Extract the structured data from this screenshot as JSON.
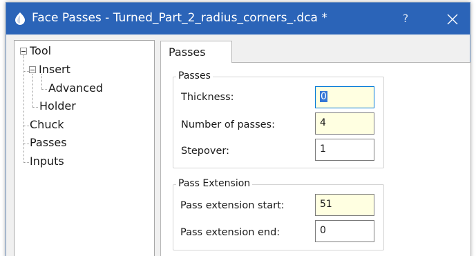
{
  "window": {
    "title": "Face Passes - Turned_Part_2_radius_corners_.dca *",
    "help_label": "?",
    "icons": {
      "app": "app-icon",
      "close": "close-icon"
    }
  },
  "tree": {
    "items": [
      {
        "label": "Tool"
      },
      {
        "label": "Insert"
      },
      {
        "label": "Advanced"
      },
      {
        "label": "Holder"
      },
      {
        "label": "Chuck"
      },
      {
        "label": "Passes"
      },
      {
        "label": "Inputs"
      }
    ]
  },
  "tab": {
    "label": "Passes"
  },
  "passes_group": {
    "label": "Passes",
    "fields": [
      {
        "label": "Thickness:",
        "value": "0"
      },
      {
        "label": "Number of passes:",
        "value": "4"
      },
      {
        "label": "Stepover:",
        "value": "1"
      }
    ]
  },
  "extension_group": {
    "label": "Pass Extension",
    "fields": [
      {
        "label": "Pass extension start:",
        "value": "51"
      },
      {
        "label": "Pass extension end:",
        "value": "0"
      }
    ]
  },
  "colors": {
    "titlebar": "#2b64b8",
    "highlight_input": "#ffffe1",
    "selection": "#3477d6"
  }
}
